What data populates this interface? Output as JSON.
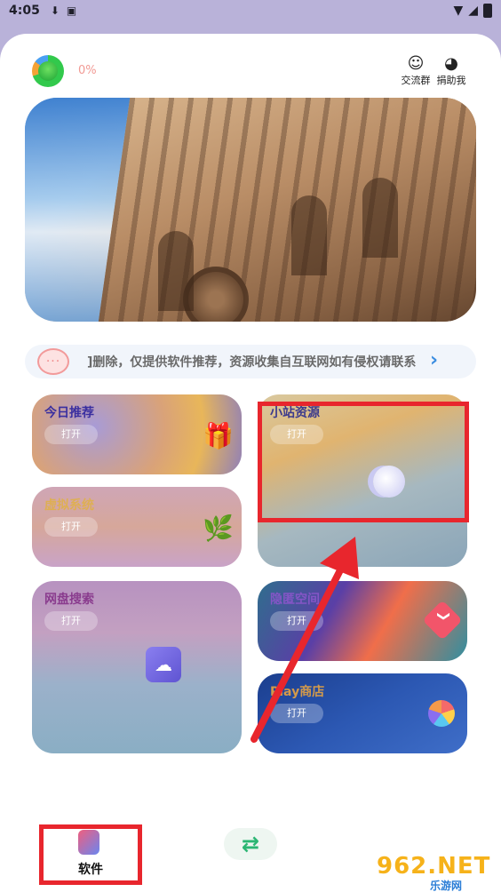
{
  "status_bar": {
    "time": "4:05"
  },
  "header": {
    "progress_percent": "0%",
    "actions": [
      {
        "label": "交流群",
        "icon": "user-avatar-icon"
      },
      {
        "label": "捐助我",
        "icon": "penguin-icon"
      }
    ]
  },
  "notice": {
    "text": "]删除，仅提供软件推荐，资源收集自互联网如有侵权请联系",
    "icon": "chat-bubble-icon"
  },
  "cards": [
    {
      "title": "今日推荐",
      "open_label": "打开"
    },
    {
      "title": "虚拟系统",
      "open_label": "打开"
    },
    {
      "title": "网盘搜索",
      "open_label": "打开"
    },
    {
      "title": "小站资源",
      "open_label": "打开"
    },
    {
      "title": "隐匿空间",
      "open_label": "打开"
    },
    {
      "title": "Play商店",
      "open_label": "打开"
    }
  ],
  "tabbar": {
    "soft_label": "软件"
  },
  "watermark": {
    "big": "962.NET",
    "small": "乐游网"
  },
  "colors": {
    "highlight": "#e8262d",
    "accent": "#3b8de0",
    "percent": "#f19a94"
  }
}
